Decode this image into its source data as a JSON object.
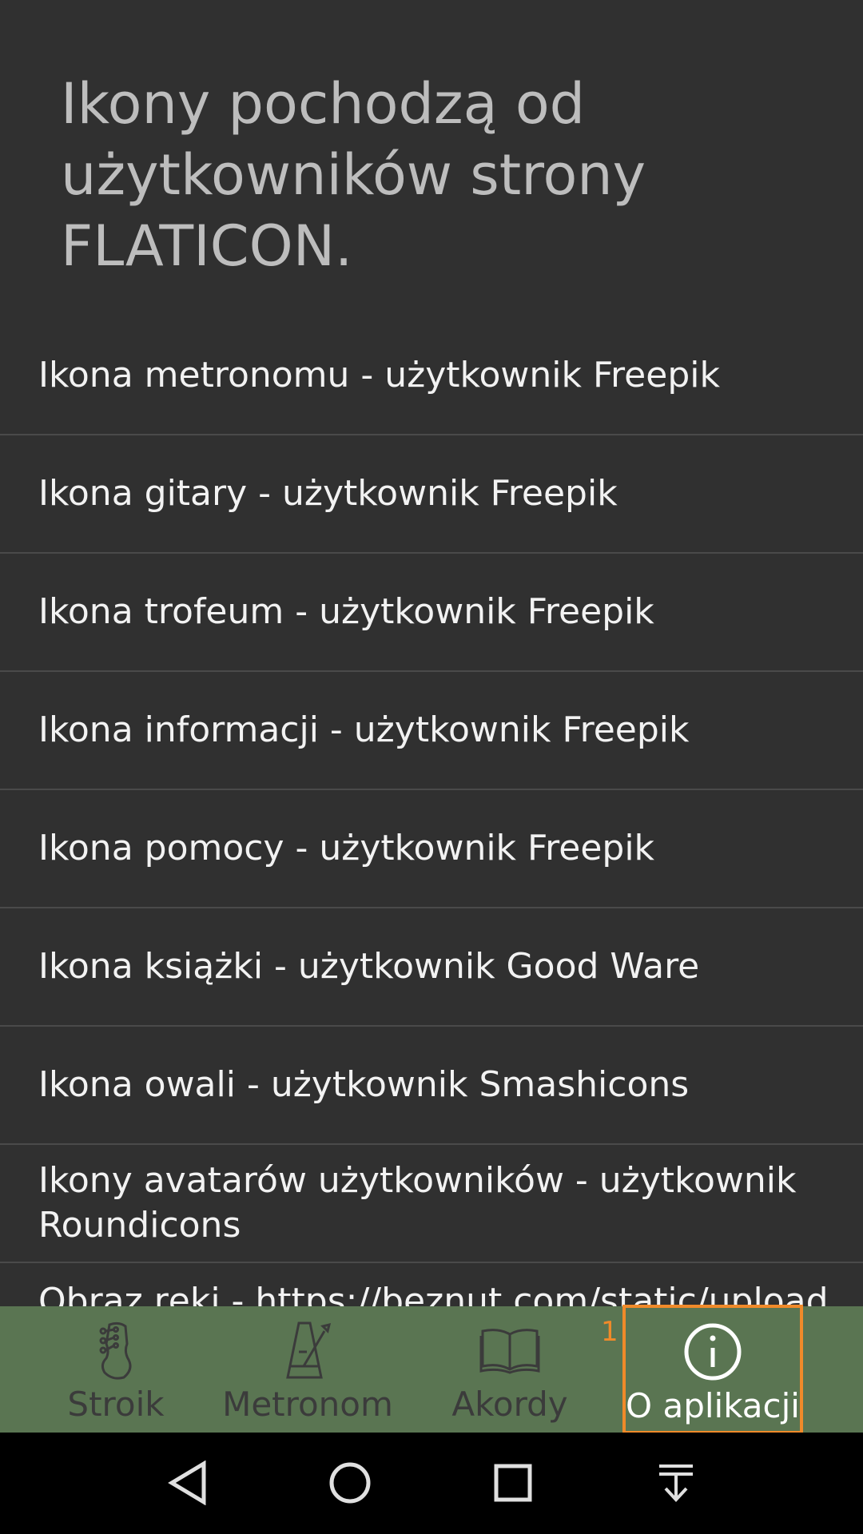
{
  "heading": "Ikony pochodzą od użytkowników strony FLATICON.",
  "credits": [
    "Ikona metronomu - użytkownik Freepik",
    "Ikona gitary - użytkownik Freepik",
    "Ikona trofeum - użytkownik Freepik",
    "Ikona informacji - użytkownik Freepik",
    "Ikona pomocy - użytkownik Freepik",
    "Ikona książki - użytkownik Good Ware",
    "Ikona owali - użytkownik Smashicons",
    "Ikony avatarów użytkowników - użytkownik Roundicons",
    "Obraz ręki - https://beznut.com/static/upload"
  ],
  "tabs": {
    "tuner": {
      "label": "Stroik",
      "icon": "guitar-headstock-icon"
    },
    "metronome": {
      "label": "Metronom",
      "icon": "metronome-icon"
    },
    "chords": {
      "label": "Akordy",
      "icon": "book-icon"
    },
    "about": {
      "label": "O aplikacji",
      "icon": "info-icon",
      "badge": "1"
    }
  },
  "colors": {
    "background": "#303030",
    "tabbar": "#5a7552",
    "highlight": "#f08a2a"
  },
  "system_nav": [
    "back-icon",
    "home-icon",
    "recents-icon",
    "notification-pull-icon"
  ]
}
